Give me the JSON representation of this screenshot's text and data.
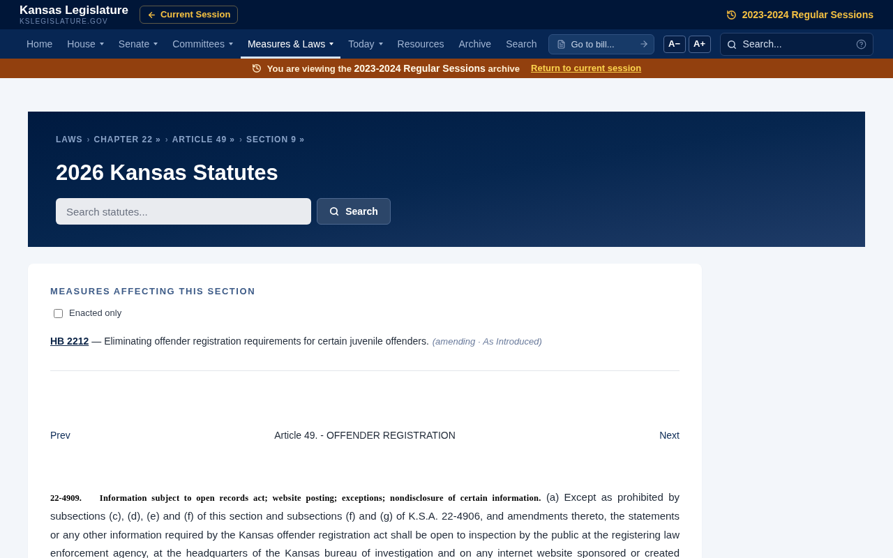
{
  "header": {
    "site_title": "Kansas Legislature",
    "site_domain": "KSLEGISLATURE.GOV",
    "current_session_button": "Current Session",
    "session_label": "2023-2024 Regular Sessions"
  },
  "nav": {
    "items": [
      {
        "label": "Home",
        "dropdown": false,
        "selected": false
      },
      {
        "label": "House",
        "dropdown": true,
        "selected": false
      },
      {
        "label": "Senate",
        "dropdown": true,
        "selected": false
      },
      {
        "label": "Committees",
        "dropdown": true,
        "selected": false
      },
      {
        "label": "Measures & Laws",
        "dropdown": true,
        "selected": true
      },
      {
        "label": "Today",
        "dropdown": true,
        "selected": false
      },
      {
        "label": "Resources",
        "dropdown": false,
        "selected": false
      },
      {
        "label": "Archive",
        "dropdown": false,
        "selected": false
      },
      {
        "label": "Search",
        "dropdown": false,
        "selected": false
      }
    ],
    "bill_field": {
      "placeholder": "Go to bill..."
    },
    "font_buttons": [
      "A−",
      "A+"
    ],
    "search": {
      "placeholder": "Search..."
    }
  },
  "archive_banner": {
    "message": "You are viewing the **2023-2024 Regular Sessions** archive",
    "link": "Return to current session"
  },
  "hero": {
    "breadcrumb": [
      {
        "label": "LAWS"
      },
      {
        "separator": "›",
        "label": "CHAPTER 22 »"
      },
      {
        "separator": "›",
        "label": "ARTICLE 49 »"
      },
      {
        "separator": "›",
        "label": "SECTION 9 »"
      }
    ],
    "title": "2026 Kansas Statutes",
    "search": {
      "placeholder": "Search statutes...",
      "button": "Search"
    }
  },
  "measures": {
    "title": "MEASURES AFFECTING THIS SECTION",
    "filter": {
      "label": "Enacted only",
      "checked": false
    },
    "items": [
      {
        "bill": "HB 2212",
        "description": "— Eliminating offender registration requirements for certain juvenile offenders.",
        "note": "(amending · As Introduced)"
      }
    ]
  },
  "article_nav": {
    "prev": "Prev",
    "title": "Article 49. - OFFENDER REGISTRATION",
    "next": "Next"
  },
  "statute": {
    "number": "22-4909.",
    "heading": "Information subject to open records act; website posting; exceptions; nondisclosure of certain information.",
    "text": "(a) Except as prohibited by subsections (c), (d), (e) and (f) of this section and subsections (f) and (g) of K.S.A. 22-4906, and amendments thereto, the statements or any other information required by the Kansas offender registration act shall be open to inspection by the public at the registering law enforcement agency, at the headquarters of the Kansas bureau of investigation and on any internet website sponsored or created"
  }
}
